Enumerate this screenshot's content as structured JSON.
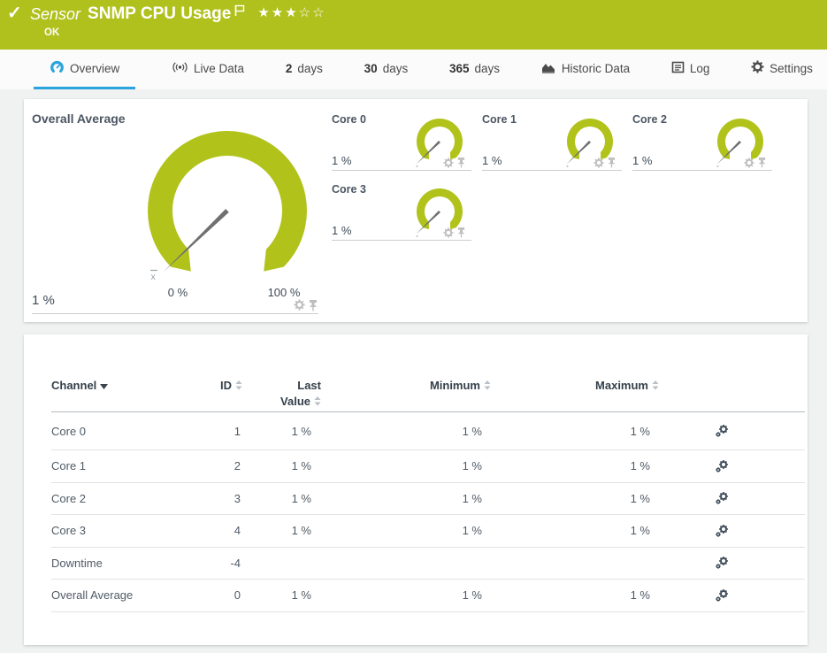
{
  "header": {
    "check_icon": "✓",
    "kind_label": "Sensor",
    "title": "SNMP CPU Usage",
    "status": "OK",
    "stars_filled": "★★★",
    "stars_empty": "☆☆"
  },
  "tabs": {
    "overview": "Overview",
    "live_data": "Live Data",
    "d2_num": "2",
    "d2_unit": "days",
    "d30_num": "30",
    "d30_unit": "days",
    "d365_num": "365",
    "d365_unit": "days",
    "historic": "Historic Data",
    "log": "Log",
    "settings": "Settings"
  },
  "gauges": {
    "overall": {
      "label": "Overall Average",
      "value": "1 %",
      "scale_min": "0 %",
      "scale_max": "100 %",
      "mean_marker": "x"
    },
    "cores": [
      {
        "label": "Core 0",
        "value": "1 %"
      },
      {
        "label": "Core 1",
        "value": "1 %"
      },
      {
        "label": "Core 2",
        "value": "1 %"
      },
      {
        "label": "Core 3",
        "value": "1 %"
      }
    ]
  },
  "table": {
    "columns": {
      "channel": "Channel",
      "id": "ID",
      "last_line1": "Last",
      "last_line2": "Value",
      "minimum": "Minimum",
      "maximum": "Maximum"
    },
    "rows": [
      {
        "channel": "Core 0",
        "id": "1",
        "last": "1 %",
        "min": "1 %",
        "max": "1 %"
      },
      {
        "channel": "Core 1",
        "id": "2",
        "last": "1 %",
        "min": "1 %",
        "max": "1 %"
      },
      {
        "channel": "Core 2",
        "id": "3",
        "last": "1 %",
        "min": "1 %",
        "max": "1 %"
      },
      {
        "channel": "Core 3",
        "id": "4",
        "last": "1 %",
        "min": "1 %",
        "max": "1 %"
      },
      {
        "channel": "Downtime",
        "id": "-4",
        "last": "",
        "min": "",
        "max": ""
      },
      {
        "channel": "Overall Average",
        "id": "0",
        "last": "1 %",
        "min": "1 %",
        "max": "1 %"
      }
    ]
  },
  "colors": {
    "header_green": "#b0c11d",
    "gauge_green": "#b1c31b",
    "accent_blue": "#2aa4dd",
    "needle_gray": "#6f6f6f"
  }
}
